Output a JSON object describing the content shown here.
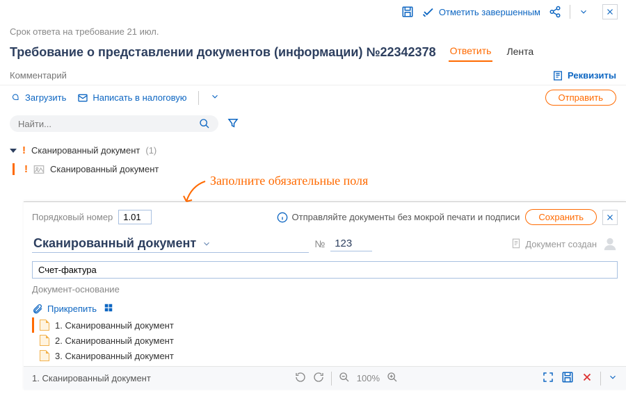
{
  "topbar": {
    "complete": "Отметить завершенным"
  },
  "deadline": "Срок ответа на требование 21 июл.",
  "title": "Требование о представлении документов (информации) №22342378",
  "tabs": {
    "reply": "Ответить",
    "feed": "Лента"
  },
  "comment": {
    "placeholder": "Комментарий",
    "details": "Реквизиты"
  },
  "actions": {
    "upload": "Загрузить",
    "write_tax": "Написать в налоговую",
    "send": "Отправить"
  },
  "search": {
    "placeholder": "Найти..."
  },
  "tree": {
    "parent": "Сканированный документ",
    "parent_count": "(1)",
    "child": "Сканированный документ"
  },
  "annotation": "Заполните обязательные поля",
  "panel": {
    "ord_label": "Порядковый номер",
    "ord_value": "1.01",
    "info": "Отправляйте документы без мокрой печати и подписи",
    "save": "Сохранить",
    "doc_name": "Сканированный документ",
    "num_label": "№",
    "num_value": "123",
    "status": "Документ создан",
    "field1": "Счет-фактура",
    "field2": "Документ-основание",
    "attach": "Прикрепить",
    "files": [
      "1. Сканированный документ",
      "2. Сканированный документ",
      "3. Сканированный документ"
    ],
    "bottom_file": "1. Сканированный документ",
    "zoom": "100%"
  }
}
